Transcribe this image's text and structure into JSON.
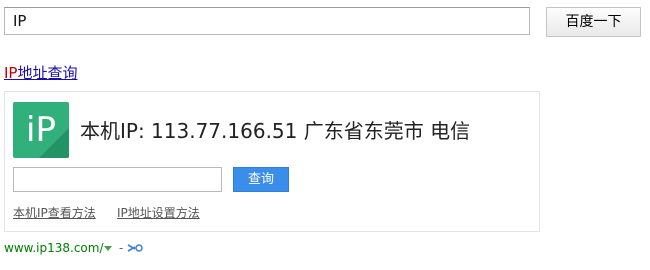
{
  "search": {
    "query": "IP",
    "button_label": "百度一下"
  },
  "result": {
    "title_highlight": "IP",
    "title_rest": "地址查询",
    "logo_text": "iP",
    "ip_line": "本机IP: 113.77.166.51  广东省东莞市 电信",
    "query_input_value": "",
    "query_button_label": "查询",
    "links": [
      {
        "label": "本机IP查看方法"
      },
      {
        "label": "IP地址设置方法"
      }
    ],
    "source_url": "www.ip138.com/",
    "separator": "-"
  },
  "colors": {
    "logo_green": "#31b07b",
    "query_button_blue": "#3a8de8",
    "url_green": "#008000",
    "title_link": "#1a0dab",
    "title_highlight": "#c00000"
  },
  "icons": [
    "dropdown-arrow-icon",
    "tool-icon"
  ]
}
